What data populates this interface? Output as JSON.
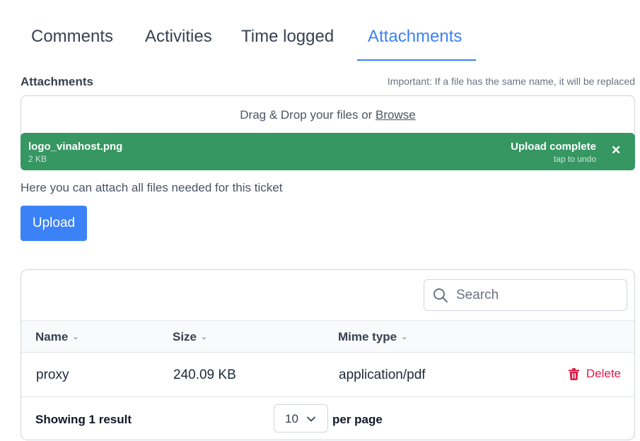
{
  "tabs": [
    {
      "label": "Comments",
      "active": false
    },
    {
      "label": "Activities",
      "active": false
    },
    {
      "label": "Time logged",
      "active": false
    },
    {
      "label": "Attachments",
      "active": true
    }
  ],
  "attachments": {
    "title": "Attachments",
    "notice": "Important: If a file has the same name, it will be replaced",
    "dropzone": {
      "text": "Drag & Drop your files or ",
      "browse_label": "Browse"
    },
    "file": {
      "name": "logo_vinahost.png",
      "size": "2 KB",
      "status": "Upload complete",
      "undo": "tap to undo",
      "close_glyph": "✕"
    },
    "help_text": "Here you can attach all files needed for this ticket",
    "upload_label": "Upload"
  },
  "table": {
    "search_placeholder": "Search",
    "columns": [
      {
        "label": "Name",
        "sort_glyph": "⌄"
      },
      {
        "label": "Size",
        "sort_glyph": "⌄"
      },
      {
        "label": "Mime type",
        "sort_glyph": "⌄"
      }
    ],
    "rows": [
      {
        "name": "proxy",
        "size": "240.09 KB",
        "mime": "application/pdf",
        "action": "Delete"
      }
    ],
    "footer": {
      "showing": "Showing 1 result",
      "per_page_value": "10",
      "per_page_label": "per page"
    }
  },
  "colors": {
    "accent": "#3b82f6",
    "success": "#369763",
    "danger": "#e11d48"
  },
  "icons": {
    "search": "search-icon",
    "delete": "trash-icon",
    "close": "close-icon",
    "chevron": "chevron-down-icon"
  }
}
